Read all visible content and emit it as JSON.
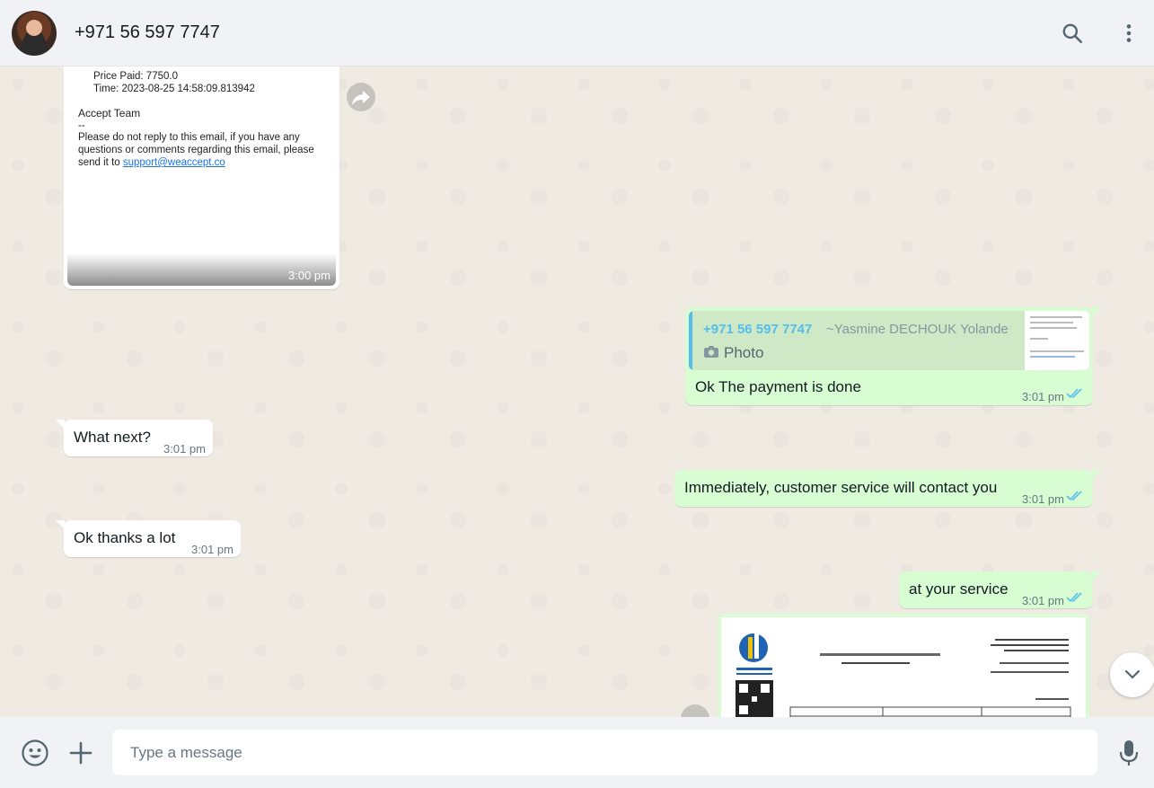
{
  "header": {
    "contact_name": "+971 56 597 7747",
    "avatar_icon": "contact-avatar",
    "search_icon": "search-icon",
    "menu_icon": "kebab-menu-icon"
  },
  "messages": {
    "email_preview": {
      "line1": "Price Paid: 7750.0",
      "line2": "Time: 2023-08-25 14:58:09.813942",
      "team": "Accept Team",
      "dashes": "--",
      "notice": "Please do not reply to this email, if you have any",
      "notice2": "questions or comments regarding this email, please",
      "notice3": "send it to",
      "link": "support@weaccept.co",
      "time": "3:00 pm"
    },
    "reply_payment": {
      "quoted_sender": "+971 56 597 7747",
      "quoted_name": "~Yasmine DECHOUK Yolande",
      "quoted_type": "Photo",
      "text": "Ok The payment is done",
      "time": "3:01 pm"
    },
    "what_next": {
      "text": "What next?",
      "time": "3:01 pm"
    },
    "customer_service": {
      "text": "Immediately, customer service will contact you",
      "time": "3:01 pm"
    },
    "thanks": {
      "text": "Ok thanks a lot",
      "time": "3:01 pm"
    },
    "at_service": {
      "text": "at your service",
      "time": "3:01 pm"
    }
  },
  "composer": {
    "placeholder": "Type a message",
    "emoji_icon": "emoji-icon",
    "attach_icon": "plus-icon",
    "mic_icon": "microphone-icon"
  },
  "colors": {
    "outgoing": "#d9fdd3",
    "incoming": "#ffffff",
    "read_ticks": "#53bdeb",
    "quote_accent": "#53bdeb"
  }
}
